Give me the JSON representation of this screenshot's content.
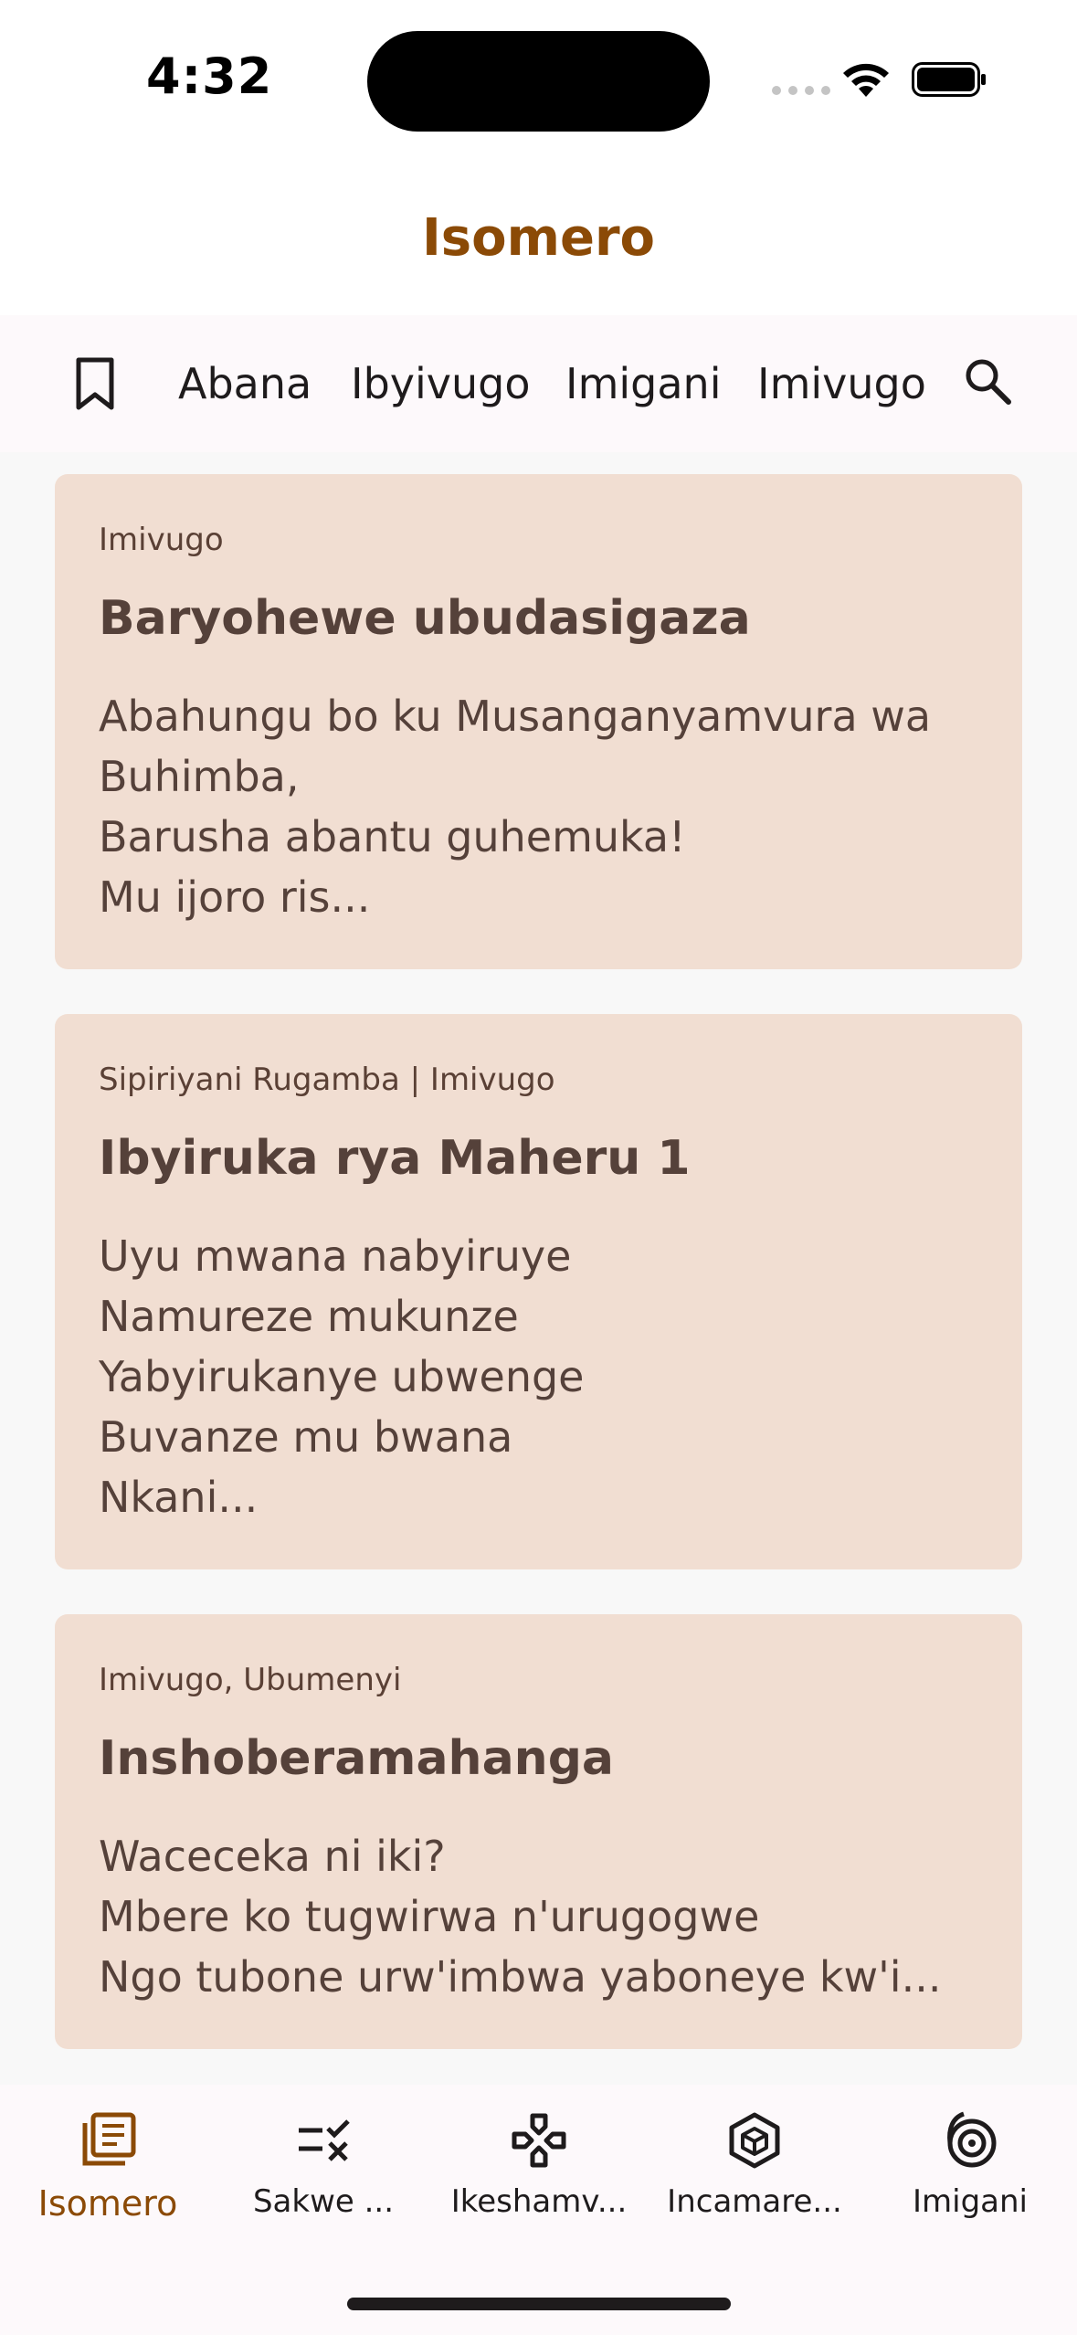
{
  "status": {
    "time": "4:32"
  },
  "app": {
    "title": "Isomero"
  },
  "tabs": [
    "Abana",
    "Ibyivugo",
    "Imigani",
    "Imivugo"
  ],
  "icons": {
    "bookmark": "bookmark-icon",
    "search": "search-icon",
    "wifi": "wifi-icon",
    "battery": "battery-icon"
  },
  "cards": [
    {
      "meta": "Imivugo",
      "title": "Baryohewe ubudasigaza",
      "excerpt": "Abahungu bo ku Musanganyamvura wa\nBuhimba,\nBarusha abantu guhemuka!\nMu ijoro ris..."
    },
    {
      "meta": "Sipiriyani Rugamba | Imivugo",
      "title": "Ibyiruka rya Maheru 1",
      "excerpt": "Uyu mwana nabyiruye\nNamureze mukunze\nYabyirukanye ubwenge\nBuvanze mu bwana\nNkani..."
    },
    {
      "meta": "Imivugo, Ubumenyi",
      "title": "Inshoberamahanga",
      "excerpt": "Waceceka ni iki?\nMbere ko tugwirwa n'urugogwe\nNgo tubone urw'imbwa yaboneye kw'i..."
    }
  ],
  "nav": [
    {
      "label": "Isomero",
      "icon": "library-icon",
      "active": true
    },
    {
      "label": "Sakwe ...",
      "icon": "quiz-icon",
      "active": false
    },
    {
      "label": "Ikeshamv...",
      "icon": "game-icon",
      "active": false
    },
    {
      "label": "Incamare...",
      "icon": "cube-icon",
      "active": false
    },
    {
      "label": "Imigani",
      "icon": "spiral-icon",
      "active": false
    }
  ],
  "colors": {
    "accent": "#8b4a06",
    "card": "#f1ded2",
    "text": "#55413a"
  }
}
